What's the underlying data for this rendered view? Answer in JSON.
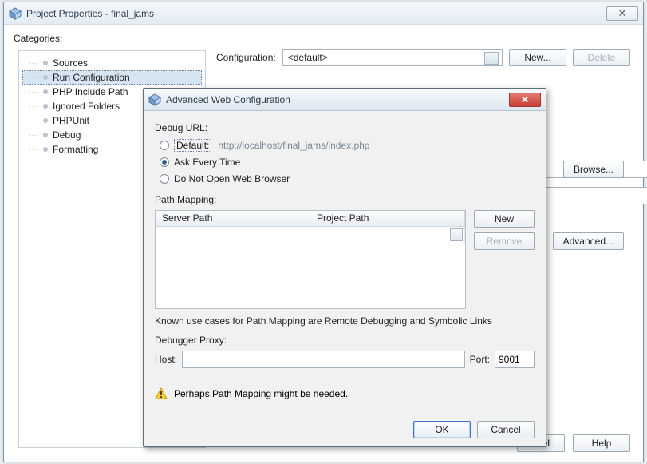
{
  "main_window": {
    "title": "Project Properties - final_jams",
    "categories_label": "Categories:",
    "categories": [
      "Sources",
      "Run Configuration",
      "PHP Include Path",
      "Ignored Folders",
      "PHPUnit",
      "Debug",
      "Formatting"
    ],
    "selected_category_index": 1,
    "configuration_label": "Configuration:",
    "configuration_value": "<default>",
    "new_btn": "New...",
    "delete_btn": "Delete",
    "browse_btn": "Browse...",
    "advanced_btn": "Advanced...",
    "help_btn": "Help"
  },
  "dialog": {
    "title": "Advanced Web Configuration",
    "debug_url_label": "Debug URL:",
    "radios": {
      "default_label": "Default:",
      "default_url": "http://localhost/final_jams/index.php",
      "ask_label": "Ask Every Time",
      "noopen_label": "Do Not Open Web Browser",
      "selected": "ask"
    },
    "path_mapping_label": "Path Mapping:",
    "table": {
      "col_server": "Server Path",
      "col_project": "Project Path",
      "new_btn": "New",
      "remove_btn": "Remove"
    },
    "known_use": "Known use cases for Path Mapping are Remote Debugging and Symbolic Links",
    "proxy_label": "Debugger Proxy:",
    "host_label": "Host:",
    "host_value": "",
    "port_label": "Port:",
    "port_value": "9001",
    "warning": "Perhaps Path Mapping might be needed.",
    "ok_btn": "OK",
    "cancel_btn": "Cancel"
  }
}
